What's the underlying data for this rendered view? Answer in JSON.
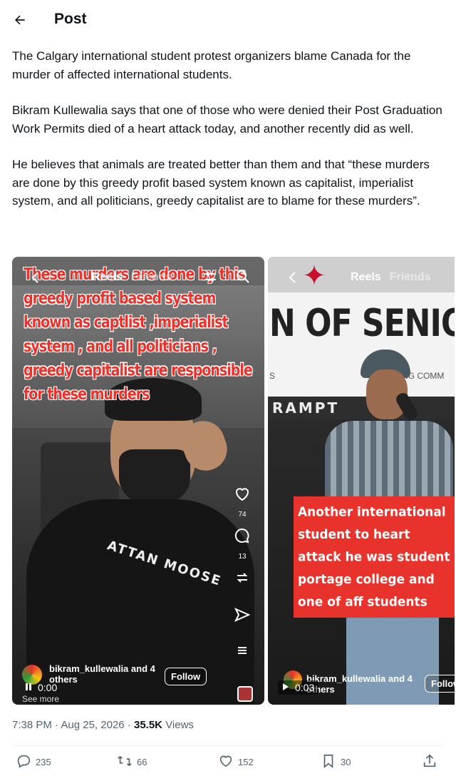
{
  "header": {
    "title": "Post"
  },
  "post": {
    "paragraphs": [
      "The Calgary international student protest organizers blame Canada for the murder of affected international students.",
      "Bikram Kullewalia says that one of those who were denied their Post Graduation Work Permits died of a heart attack today, and another recently did as well.",
      "He believes that animals are treated better than them and that “these murders are done by this greedy profit based system known as capitalist, imperialist system, and all politicians, greedy capitalist are to blame for these murders”."
    ],
    "time": "7:38 PM",
    "date": "Aug 25, 2026",
    "separator": "·",
    "views_count": "35.5K",
    "views_label": "Views"
  },
  "media1": {
    "overlay_text": "These murders are done by this greedy profit based system known as captlist ,imperialist system , and all politicians , greedy capitalist are responsible for these murders",
    "tab_reels": "Reels",
    "tab_friends": "Friends",
    "likes": "74",
    "comments": "13",
    "author": "bikram_kullewalia and 4 others",
    "follow": "Follow",
    "time": "0:00",
    "see_more": "See more",
    "shirt_text": "ATTAN MOOSE"
  },
  "media2": {
    "tab_reels": "Reels",
    "tab_friends": "Friends",
    "banner": "N OF SENIOR C",
    "banner_small_left": "S",
    "banner_small_right": "NG COMM",
    "banner2": "RAMPT",
    "overlay_text": "Another international student to heart attack he was student portage college and one of aff students",
    "author": "bikram_kullewalia and 4 others",
    "follow": "Follow",
    "time": "0:03"
  },
  "actions": {
    "replies": "235",
    "reposts": "66",
    "likes": "152",
    "bookmarks": "30"
  },
  "colors": {
    "accent_red": "#e7332b",
    "text": "#0f1419",
    "muted": "#536471"
  }
}
